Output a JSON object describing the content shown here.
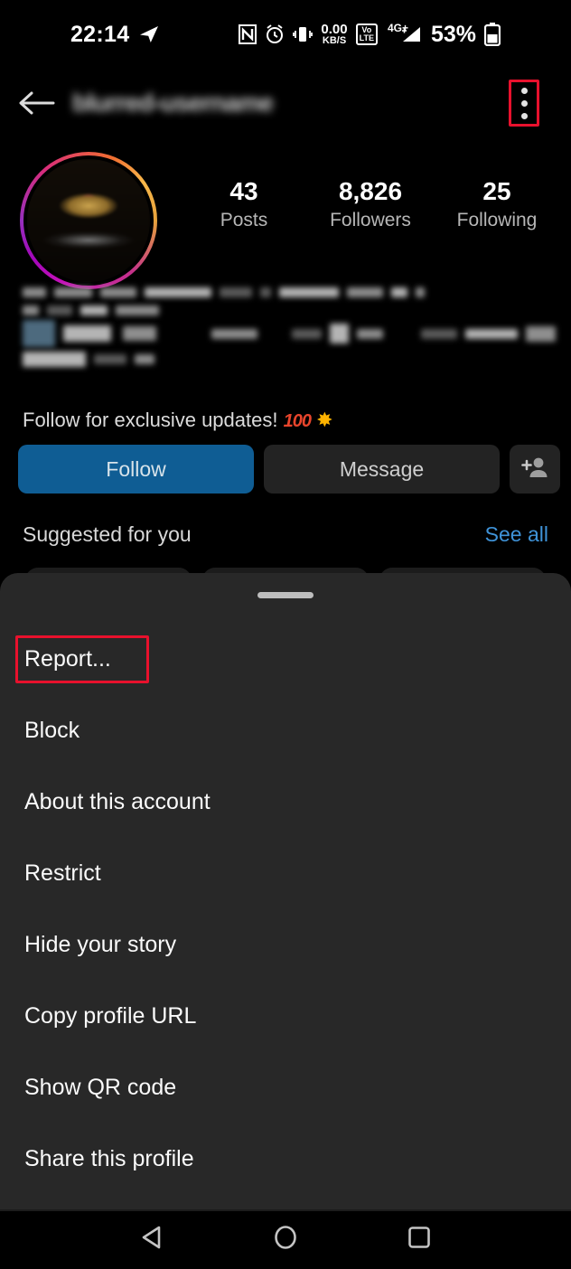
{
  "status_bar": {
    "time": "22:14",
    "icons": [
      "telegram-send-icon",
      "nfc-icon",
      "alarm-icon",
      "vibrate-icon"
    ],
    "network_speed_value": "0.00",
    "network_speed_unit": "KB/S",
    "volte_top": "Vo",
    "volte_bottom": "LTE",
    "network_type": "4G+",
    "battery_percent": "53%"
  },
  "app_bar": {
    "back_label": "back",
    "username": "blurred-username",
    "username_redacted": true,
    "menu_label": "more options"
  },
  "profile": {
    "stats": [
      {
        "value": "43",
        "label": "Posts"
      },
      {
        "value": "8,826",
        "label": "Followers"
      },
      {
        "value": "25",
        "label": "Following"
      }
    ],
    "bio_redacted": true,
    "bio_visible_text": "Follow for exclusive updates!",
    "bio_emoji_100": "100",
    "bio_emoji_boom": "✸",
    "buttons": {
      "follow": "Follow",
      "message": "Message",
      "add_user": "add-user"
    },
    "suggested": {
      "title": "Suggested for you",
      "see_all": "See all"
    }
  },
  "bottom_sheet": {
    "handle": "drag-handle",
    "items": [
      {
        "label": "Report...",
        "highlighted": true
      },
      {
        "label": "Block",
        "highlighted": false
      },
      {
        "label": "About this account",
        "highlighted": false
      },
      {
        "label": "Restrict",
        "highlighted": false
      },
      {
        "label": "Hide your story",
        "highlighted": false
      },
      {
        "label": "Copy profile URL",
        "highlighted": false
      },
      {
        "label": "Show QR code",
        "highlighted": false
      },
      {
        "label": "Share this profile",
        "highlighted": false
      }
    ]
  },
  "nav_bar": {
    "back": "back-triangle",
    "home": "home-circle",
    "recents": "recents-square"
  },
  "colors": {
    "background": "#000000",
    "sheet_background": "#282828",
    "follow_button": "#0f5d94",
    "message_button": "#232323",
    "link_blue": "#3f93d8",
    "highlight_red": "#e8112d",
    "text_primary": "#fafafa",
    "text_secondary": "#b6b6b6"
  }
}
